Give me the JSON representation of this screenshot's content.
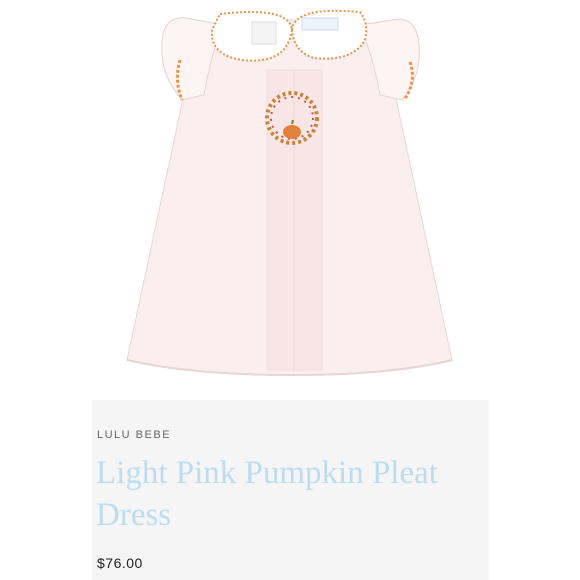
{
  "product": {
    "brand": "LULU BEBE",
    "title": "Light Pink Pumpkin Pleat Dress",
    "price": "$76.00",
    "image": {
      "subject": "dress-photo",
      "colors": {
        "dress": "#fbeeee",
        "dress_shadow": "#efdede",
        "collar": "#ffffff",
        "trim": "#e8944a",
        "wreath": "#c8843a",
        "pumpkin": "#e2823a"
      }
    }
  },
  "colors": {
    "title": "#bcdcf2",
    "brand": "#666666",
    "price": "#222222",
    "card_bg": "#f5f5f5"
  }
}
